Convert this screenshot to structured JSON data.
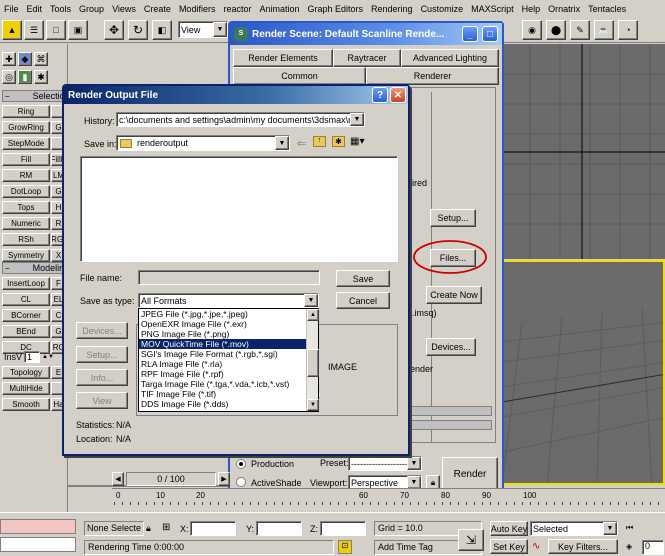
{
  "menubar": {
    "items": [
      "File",
      "Edit",
      "Tools",
      "Group",
      "Views",
      "Create",
      "Modifiers",
      "reactor",
      "Animation",
      "Graph Editors",
      "Rendering",
      "Customize",
      "MAXScript",
      "Help",
      "Ornatrix",
      "Tentacles"
    ]
  },
  "toolbar": {
    "view_dropdown": "View"
  },
  "left_panel": {
    "selection_header": "Selectio",
    "rows": [
      [
        "Ring",
        ""
      ],
      [
        "GrowRing",
        "G"
      ],
      [
        "StepMode",
        ""
      ],
      [
        "Fill",
        "FillH"
      ],
      [
        "RM",
        "LM"
      ],
      [
        "DotLoop",
        "G"
      ],
      [
        "Tops",
        "H"
      ],
      [
        "Numeric",
        "R"
      ],
      [
        "RSh",
        "RGr"
      ],
      [
        "Symmetry",
        "X"
      ]
    ],
    "modeling_header": "Modeling",
    "rows2": [
      [
        "InsertLoop",
        "F"
      ],
      [
        "CL",
        "EL"
      ],
      [
        "BCorner",
        "C"
      ],
      [
        "BEnd",
        "G"
      ],
      [
        "DC",
        "RC"
      ]
    ],
    "insv_label": "InsV",
    "insv_value": "1",
    "rows3": [
      [
        "Topology",
        "E"
      ],
      [
        "MultiHide",
        ""
      ],
      [
        "Smooth",
        "Ha"
      ]
    ]
  },
  "render_scene": {
    "title": "Render Scene: Default Scanline Rende...",
    "tabs_row1": [
      "Render Elements",
      "Raytracer",
      "Advanced Lighting"
    ],
    "tabs_row2": [
      "Common",
      "Renderer"
    ],
    "required_text": "uired",
    "setup_button": "Setup...",
    "files_button": "Files...",
    "create_now_button": "Create Now",
    "imsq_text": "(.imsq)",
    "devices_button": "Devices...",
    "render_text": "ender",
    "production_label": "Production",
    "activeshade_label": "ActiveShade",
    "preset_label": "Preset:",
    "preset_value": "-------------------",
    "viewport_label": "Viewport:",
    "viewport_value": "Perspective",
    "render_button": "Render"
  },
  "render_output": {
    "title": "Render Output File",
    "history_label": "History:",
    "history_value": "c:\\documents and settings\\admin\\my documents\\3dsmax\\rend",
    "savein_label": "Save in:",
    "savein_value": "renderoutput",
    "filename_label": "File name:",
    "filename_value": "",
    "saveas_label": "Save as type:",
    "saveas_value": "All Formats",
    "save_button": "Save",
    "cancel_button": "Cancel",
    "devices_button": "Devices...",
    "setup_button": "Setup...",
    "info_button": "Info...",
    "view_button": "View",
    "image_label": "IMAGE",
    "statistics_label": "Statistics:",
    "statistics_value": "N/A",
    "location_label": "Location:",
    "location_value": "N/A",
    "file_types": [
      "JPEG File (*.jpg,*.jpe,*.jpeg)",
      "OpenEXR Image File (*.exr)",
      "PNG Image File (*.png)",
      "MOV QuickTime File (*.mov)",
      "SGI's Image File Format (*.rgb,*.sgi)",
      "RLA Image File (*.rla)",
      "RPF Image File (*.rpf)",
      "Targa Image File (*.tga,*.vda,*.icb,*.vst)",
      "TIF Image File (*.tif)",
      "DDS Image File (*.dds)"
    ],
    "selected_type": "MOV QuickTime File (*.mov)"
  },
  "timeline": {
    "frame_counter": "0 / 100",
    "ticks": [
      "0",
      "10",
      "20",
      "60",
      "70",
      "80",
      "90",
      "100"
    ]
  },
  "statusbar": {
    "selection": "None Selecte",
    "x_label": "X:",
    "y_label": "Y:",
    "z_label": "Z:",
    "grid": "Grid = 10.0",
    "rendering_time": "Rendering Time  0:00:00",
    "add_time_tag": "Add Time Tag",
    "auto_key": "Auto Key",
    "selected_value": "Selected",
    "set_key": "Set Key",
    "key_filters": "Key Filters...",
    "frame_value": "0"
  },
  "colors": {
    "viewport_bg": "#6b6b6b",
    "selected_viewport_border": "#f0e000",
    "highlight": "#0a246a",
    "annotation_ellipse": "#cc0000"
  }
}
